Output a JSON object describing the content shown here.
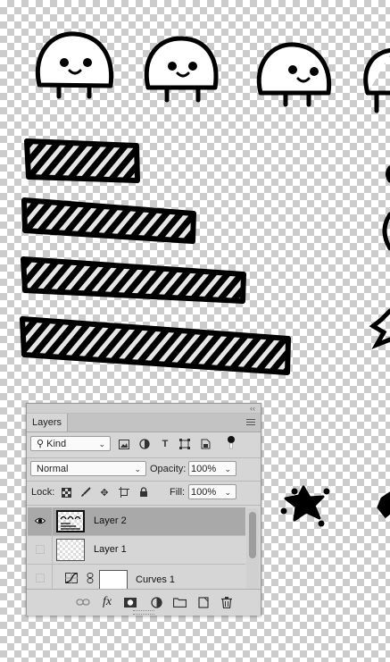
{
  "layers_panel": {
    "tab_label": "Layers",
    "filter": {
      "kind_label": "Kind"
    },
    "blend_mode": "Normal",
    "opacity_label": "Opacity:",
    "opacity_value": "100%",
    "lock_label": "Lock:",
    "fill_label": "Fill:",
    "fill_value": "100%",
    "layers": [
      {
        "name": "Layer 2",
        "visible": true,
        "selected": true
      },
      {
        "name": "Layer 1",
        "visible": false,
        "selected": false
      },
      {
        "name": "Curves 1",
        "visible": false,
        "selected": false,
        "type": "adjustment"
      }
    ],
    "bottom_tools": [
      "link-icon",
      "fx-icon",
      "mask-icon",
      "adjustment-icon",
      "folder-icon",
      "new-layer-icon",
      "trash-icon"
    ]
  },
  "canvas": {
    "background": "transparency-checkerboard",
    "ink_color": "#000000"
  }
}
